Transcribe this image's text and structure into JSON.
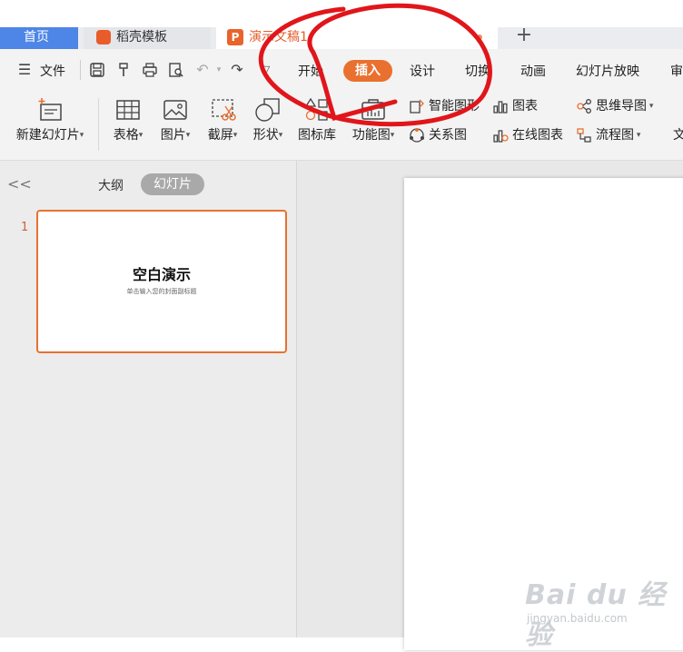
{
  "tabs": {
    "home": "首页",
    "template": "稻壳模板",
    "document": "演示文稿1",
    "document_icon": "P",
    "new_tab": "+"
  },
  "menubar": {
    "file": "文件",
    "tabs": [
      "开始",
      "插入",
      "设计",
      "切换",
      "动画",
      "幻灯片放映",
      "审"
    ],
    "active_tab": "插入"
  },
  "ribbon": {
    "new_slide": "新建幻灯片",
    "table": "表格",
    "picture": "图片",
    "screenshot": "截屏",
    "shape": "形状",
    "icon_lib": "图标库",
    "func_chart": "功能图",
    "smart_shape": "智能图形",
    "chart": "图表",
    "mind_map": "思维导图",
    "relation": "关系图",
    "online_chart": "在线图表",
    "flow_chart": "流程图",
    "text_cut": "文"
  },
  "panel": {
    "collapse": "<<",
    "outline": "大纲",
    "slides": "幻灯片",
    "slide_number": "1"
  },
  "thumbnail": {
    "title": "空白演示",
    "subtitle": "单击输入您的封面副标题"
  },
  "watermark": {
    "brand": "Bai du 经验",
    "url": "jingyan.baidu.com"
  },
  "colors": {
    "accent": "#e9702f",
    "tab_home": "#4d86e6",
    "annotation": "#e0161b"
  }
}
